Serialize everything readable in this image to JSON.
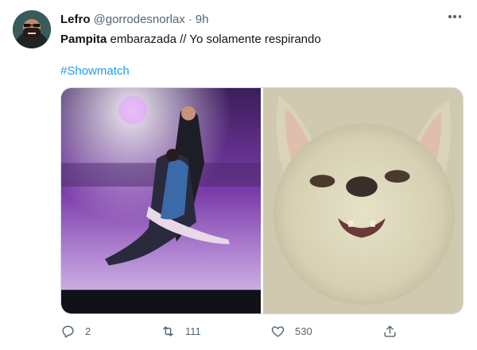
{
  "tweet": {
    "author_name": "Lefro",
    "author_handle": "@gorrodesnorlax",
    "separator": "·",
    "time": "9h",
    "text_bold": "Pampita",
    "text_rest": " embarazada // Yo solamente respirando",
    "hashtag": "#Showmatch",
    "media": [
      {
        "description": "dancing couple on stage"
      },
      {
        "description": "squinting white dog"
      }
    ]
  },
  "actions": {
    "reply": {
      "icon": "reply-icon",
      "count": "2"
    },
    "retweet": {
      "icon": "retweet-icon",
      "count": "111"
    },
    "like": {
      "icon": "like-icon",
      "count": "530"
    },
    "share": {
      "icon": "share-icon"
    }
  },
  "colors": {
    "link": "#1d9bf0",
    "secondary_text": "#536471",
    "primary_text": "#0f1419"
  }
}
